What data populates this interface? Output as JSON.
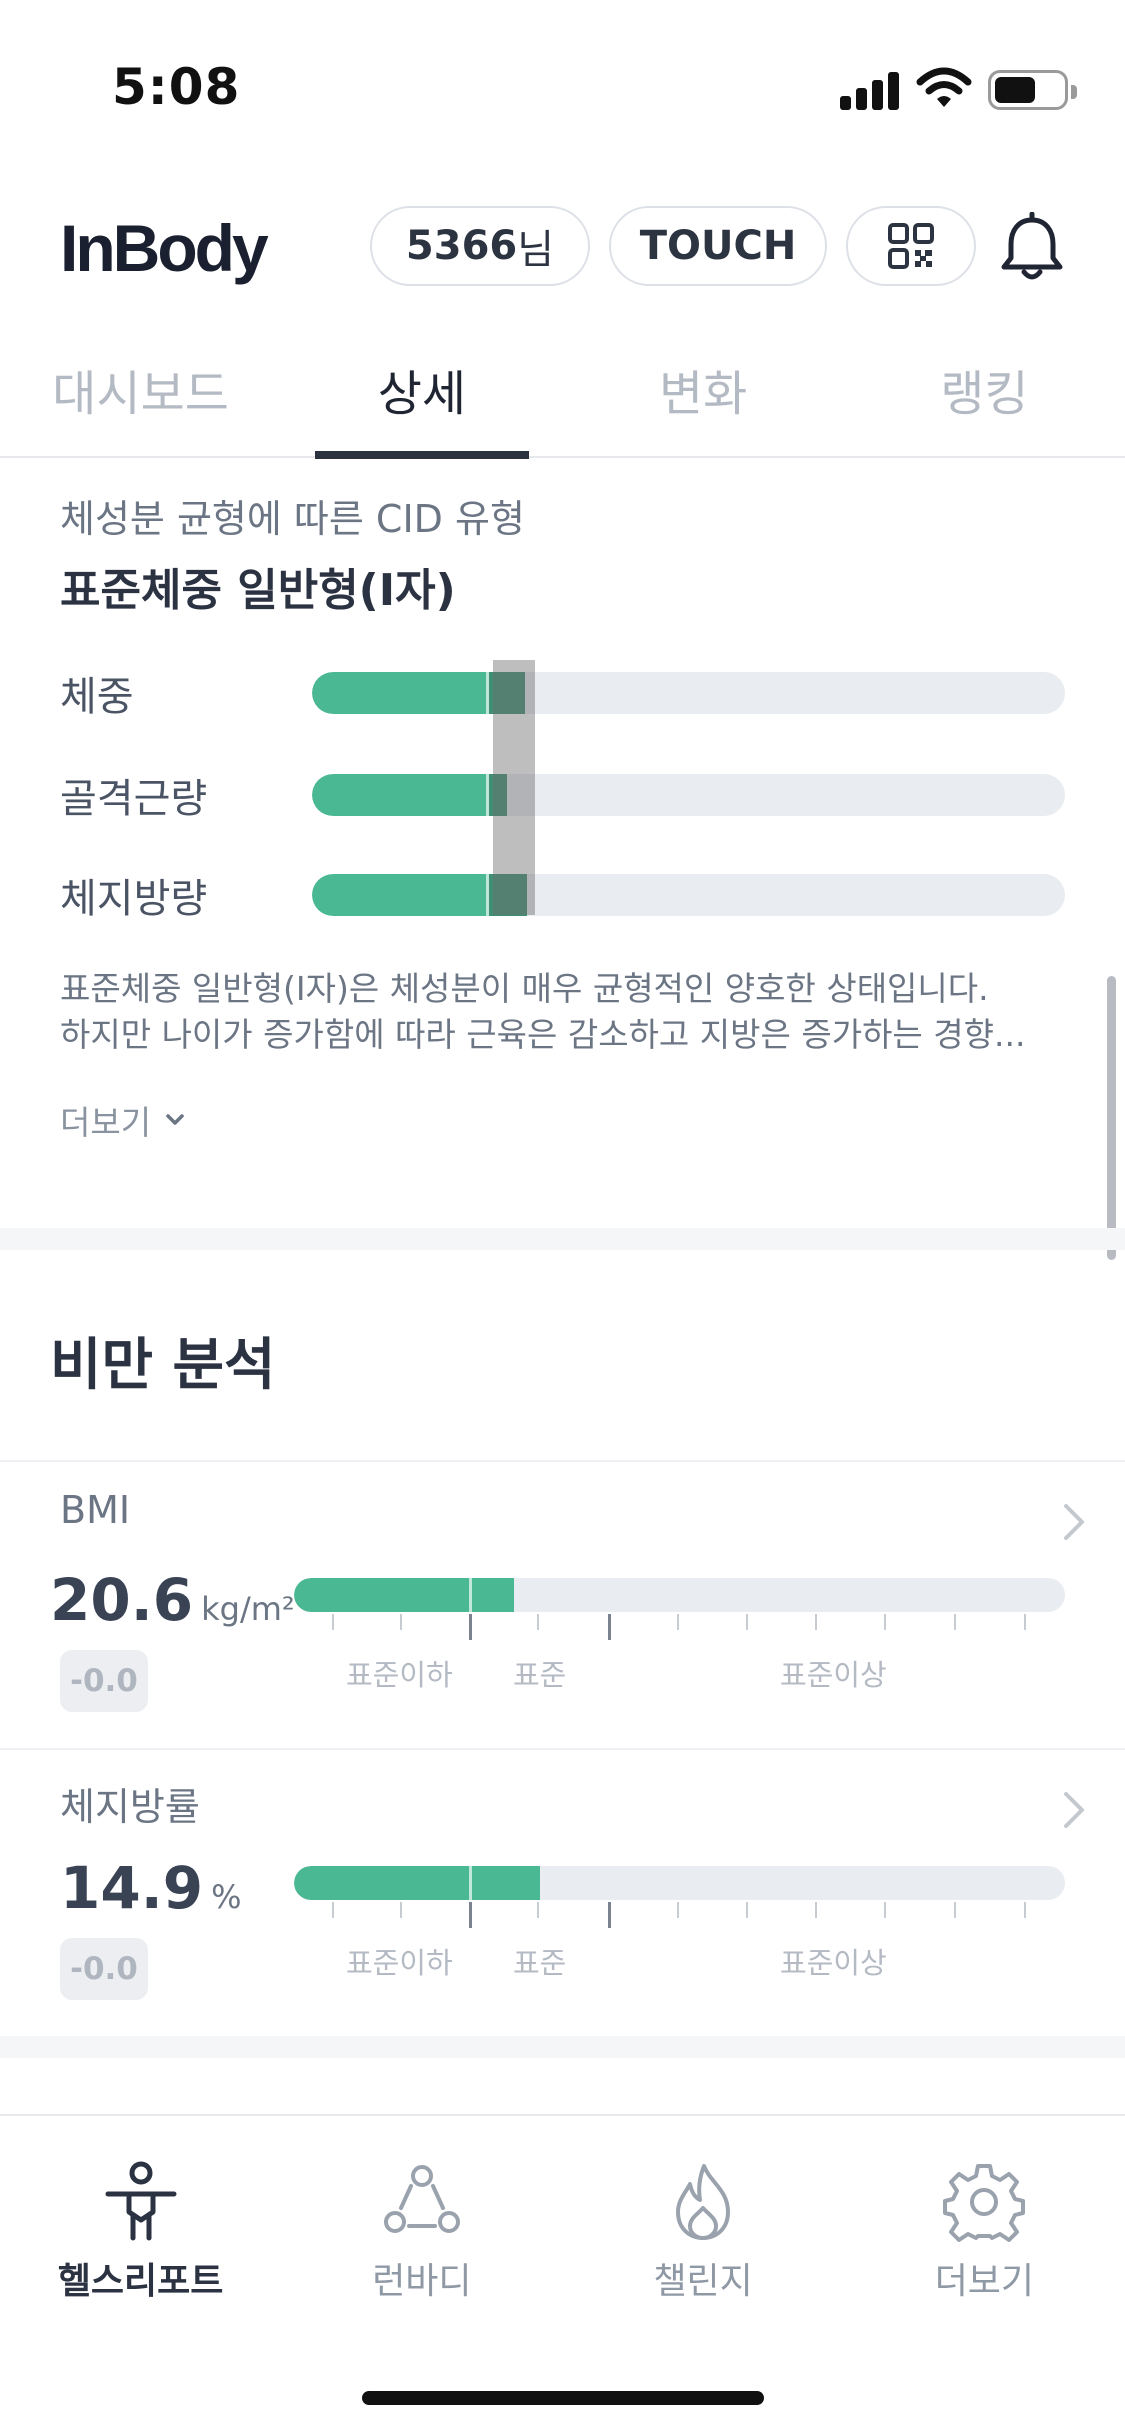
{
  "status": {
    "time": "5:08"
  },
  "header": {
    "logo": "InBody",
    "user_id": "5366",
    "user_suffix": "님",
    "touch_label": "TOUCH"
  },
  "tabs": [
    {
      "label": "대시보드",
      "active": false
    },
    {
      "label": "상세",
      "active": true
    },
    {
      "label": "변화",
      "active": false
    },
    {
      "label": "랭킹",
      "active": false
    }
  ],
  "cid": {
    "subtitle": "체성분 균형에 따른 CID 유형",
    "title": "표준체중 일반형(I자)",
    "rows": [
      {
        "label": "체중"
      },
      {
        "label": "골격근량"
      },
      {
        "label": "체지방량"
      }
    ],
    "description_line1": "표준체중 일반형(I자)은 체성분이 매우 균형적인 양호한 상태입니다.",
    "description_line2": "하지만 나이가 증가함에 따라 근육은 감소하고 지방은 증가하는 경향...",
    "more_label": "더보기"
  },
  "obesity": {
    "title": "비만 분석",
    "metrics": [
      {
        "label": "BMI",
        "value": "20.6",
        "unit": "kg/m²",
        "change": "-0.0",
        "zones": [
          "표준이하",
          "표준",
          "표준이상"
        ]
      },
      {
        "label": "체지방률",
        "value": "14.9",
        "unit": "%",
        "change": "-0.0",
        "zones": [
          "표준이하",
          "표준",
          "표준이상"
        ]
      }
    ]
  },
  "bottom_nav": [
    {
      "label": "헬스리포트",
      "icon": "person-icon",
      "active": true
    },
    {
      "label": "런바디",
      "icon": "group-icon",
      "active": false
    },
    {
      "label": "챌린지",
      "icon": "flame-icon",
      "active": false
    },
    {
      "label": "더보기",
      "icon": "gear-icon",
      "active": false
    }
  ],
  "colors": {
    "accent_green": "#4bb894",
    "accent_dark_green": "#3e8f73",
    "text_primary": "#2b3241",
    "text_secondary": "#6b7584"
  }
}
